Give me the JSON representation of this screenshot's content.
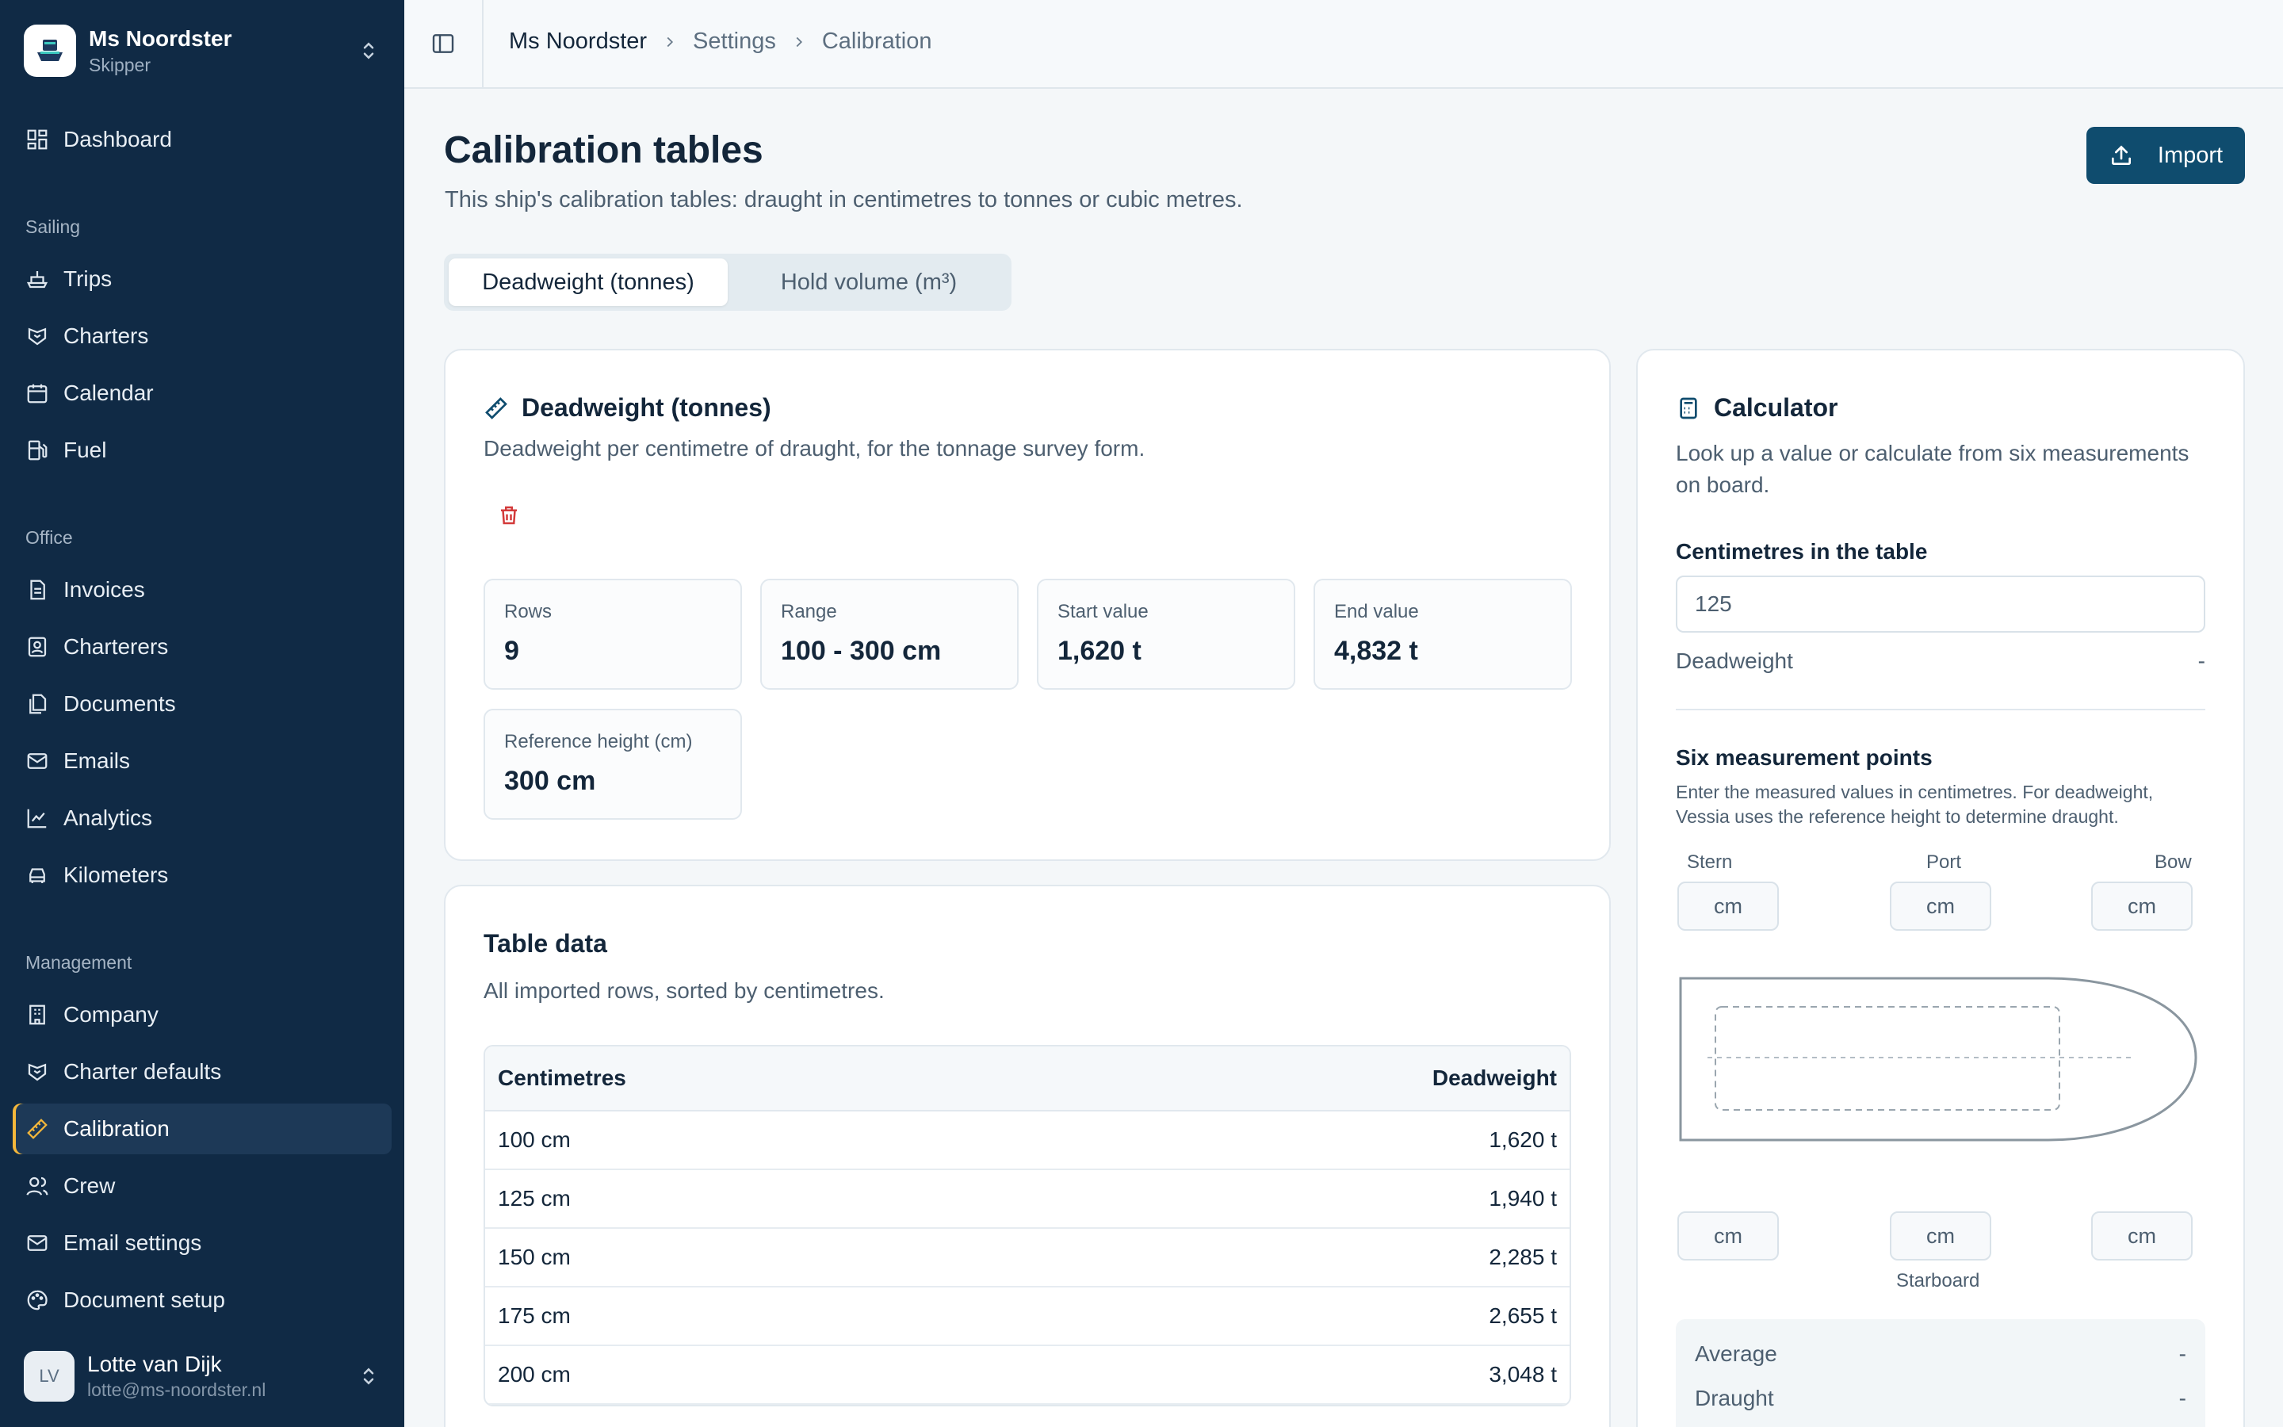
{
  "sidebar": {
    "ship_name": "Ms Noordster",
    "ship_role": "Skipper",
    "top_items": [
      {
        "label": "Dashboard",
        "icon": "dashboard-icon"
      }
    ],
    "sections": [
      {
        "title": "Sailing",
        "items": [
          {
            "label": "Trips",
            "icon": "ship-icon"
          },
          {
            "label": "Charters",
            "icon": "handshake-icon"
          },
          {
            "label": "Calendar",
            "icon": "calendar-icon"
          },
          {
            "label": "Fuel",
            "icon": "fuel-icon"
          }
        ]
      },
      {
        "title": "Office",
        "items": [
          {
            "label": "Invoices",
            "icon": "invoice-icon"
          },
          {
            "label": "Charterers",
            "icon": "contacts-icon"
          },
          {
            "label": "Documents",
            "icon": "documents-icon"
          },
          {
            "label": "Emails",
            "icon": "mail-icon"
          },
          {
            "label": "Analytics",
            "icon": "chart-icon"
          },
          {
            "label": "Kilometers",
            "icon": "car-icon"
          }
        ]
      },
      {
        "title": "Management",
        "items": [
          {
            "label": "Company",
            "icon": "building-icon"
          },
          {
            "label": "Charter defaults",
            "icon": "handshake-icon"
          },
          {
            "label": "Calibration",
            "icon": "ruler-icon",
            "active": true
          },
          {
            "label": "Crew",
            "icon": "users-icon"
          },
          {
            "label": "Email settings",
            "icon": "mail-settings-icon"
          },
          {
            "label": "Document setup",
            "icon": "palette-icon"
          }
        ]
      }
    ],
    "user": {
      "initials": "LV",
      "name": "Lotte van Dijk",
      "email": "lotte@ms-noordster.nl"
    }
  },
  "breadcrumb": [
    "Ms Noordster",
    "Settings",
    "Calibration"
  ],
  "header": {
    "title": "Calibration tables",
    "subtitle": "This ship's calibration tables: draught in centimetres to tonnes or cubic metres.",
    "import_label": "Import"
  },
  "tabs": [
    {
      "label": "Deadweight (tonnes)",
      "active": true
    },
    {
      "label": "Hold volume (m³)",
      "active": false
    }
  ],
  "summary": {
    "title": "Deadweight (tonnes)",
    "description": "Deadweight per centimetre of draught, for the tonnage survey form.",
    "stats": [
      {
        "label": "Rows",
        "value": "9"
      },
      {
        "label": "Range",
        "value": "100 - 300 cm"
      },
      {
        "label": "Start value",
        "value": "1,620 t"
      },
      {
        "label": "End value",
        "value": "4,832 t"
      },
      {
        "label": "Reference height (cm)",
        "value": "300 cm"
      }
    ]
  },
  "table": {
    "title": "Table data",
    "subtitle": "All imported rows, sorted by centimetres.",
    "columns": [
      "Centimetres",
      "Deadweight"
    ],
    "rows": [
      [
        "100 cm",
        "1,620 t"
      ],
      [
        "125 cm",
        "1,940 t"
      ],
      [
        "150 cm",
        "2,285 t"
      ],
      [
        "175 cm",
        "2,655 t"
      ],
      [
        "200 cm",
        "3,048 t"
      ]
    ]
  },
  "calculator": {
    "title": "Calculator",
    "description": "Look up a value or calculate from six measurements on board.",
    "lookup_label": "Centimetres in the table",
    "lookup_placeholder": "125",
    "result_label": "Deadweight",
    "result_value": "-",
    "six_title": "Six measurement points",
    "six_desc": "Enter the measured values in centimetres. For deadweight, Vessia uses the reference height to determine draught.",
    "top_labels": [
      "Stern",
      "Port",
      "Bow"
    ],
    "unit": "cm",
    "starboard_label": "Starboard",
    "average_label": "Average",
    "average_value": "-",
    "draught_label": "Draught",
    "draught_value": "-"
  },
  "colors": {
    "sidebar": "#102a45",
    "primary": "#0f4c6e",
    "active_indicator": "#f4b73b",
    "danger": "#d33a3a"
  }
}
